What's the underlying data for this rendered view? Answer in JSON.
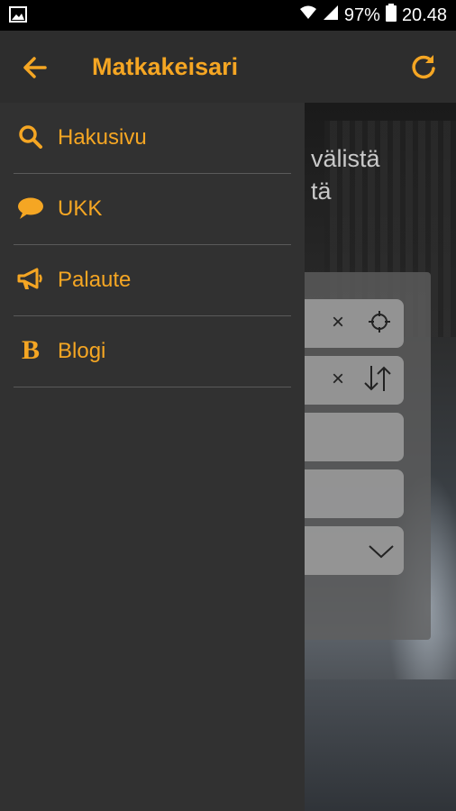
{
  "status_bar": {
    "battery": "97%",
    "time": "20.48"
  },
  "app_bar": {
    "title": "Matkakeisari"
  },
  "drawer": {
    "items": [
      {
        "label": "Hakusivu",
        "icon": "search-icon"
      },
      {
        "label": "UKK",
        "icon": "chat-bubble-icon"
      },
      {
        "label": "Palaute",
        "icon": "megaphone-icon"
      },
      {
        "label": "Blogi",
        "icon": "blog-b-icon"
      }
    ]
  },
  "background": {
    "heading_line1": "välistä",
    "heading_line2": "tä",
    "clear_symbol": "×"
  },
  "colors": {
    "accent": "#f5a623",
    "appbar": "#2d2d2d",
    "drawer": "#313131",
    "divider": "#5a5a5a"
  }
}
